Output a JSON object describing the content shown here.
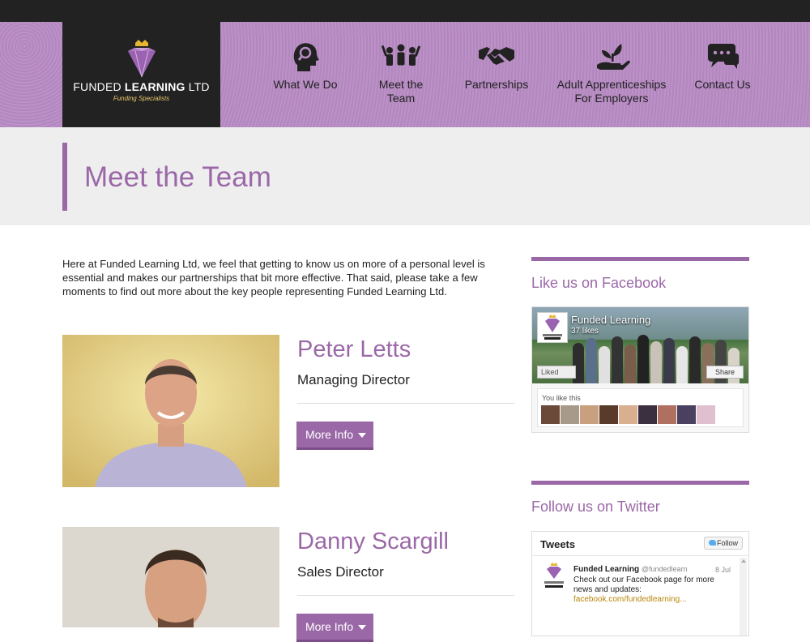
{
  "brand": {
    "name_light": "FUNDED ",
    "name_bold": "LEARNING",
    "name_suffix": " LTD",
    "tagline": "Funding Specialists"
  },
  "nav": {
    "items": [
      {
        "label": "What We Do",
        "icon": "head-search-icon"
      },
      {
        "label": "Meet the Team",
        "icon": "team-icon"
      },
      {
        "label": "Partnerships",
        "icon": "handshake-icon"
      },
      {
        "label_line1": "Adult Apprenticeships",
        "label_line2": "For Employers",
        "icon": "plant-hand-icon"
      },
      {
        "label": "Contact Us",
        "icon": "chat-bubbles-icon"
      }
    ]
  },
  "page": {
    "title": "Meet the Team",
    "intro": "Here at Funded Learning Ltd, we feel that getting to know us on more of a personal level is essential and makes our partnerships that bit more effective. That said, please take a few moments to find out more about the key people representing Funded Learning Ltd."
  },
  "team": [
    {
      "name": "Peter Letts",
      "role": "Managing Director",
      "button": "More Info"
    },
    {
      "name": "Danny Scargill",
      "role": "Sales Director",
      "button": "More Info"
    }
  ],
  "sidebar": {
    "facebook": {
      "heading": "Like us on Facebook",
      "page_name": "Funded Learning",
      "likes": "37 likes",
      "liked_label": "Liked",
      "share_label": "Share",
      "you_like_this": "You like this"
    },
    "twitter": {
      "heading": "Follow us on Twitter",
      "widget_title": "Tweets",
      "follow_label": "Follow",
      "tweet": {
        "author": "Funded Learning",
        "handle": "@fundedlearn",
        "date": "8 Jul",
        "text": "Check out our Facebook page for more news and updates:",
        "link": "facebook.com/fundedlearning..."
      }
    }
  },
  "colors": {
    "accent": "#9b68a7",
    "header_bg": "#b88bc4",
    "dark": "#222222"
  }
}
